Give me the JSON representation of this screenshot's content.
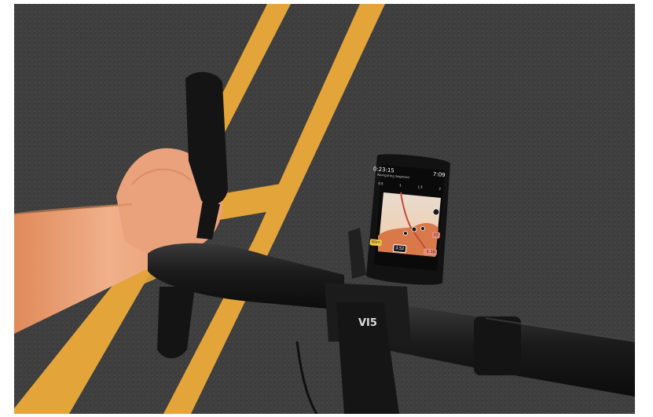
{
  "photo": {
    "description_icon": "road-cycling-photo",
    "frame_brand_text": "VI5"
  },
  "device": {
    "timer": "0:23:15",
    "status": "7:09",
    "subtitle": "Navigating Segment",
    "scale_ticks": [
      "0.5",
      "1",
      "1.5",
      "2"
    ],
    "box_left": "80m",
    "box_mid": "3.52",
    "box_right": "-1.18",
    "box_right2": "33"
  },
  "colors": {
    "road": "#3b3b3b",
    "lane_yellow": "#e0a63c",
    "map_sand": "#f0c8a0",
    "profile_orange": "#d9794a"
  }
}
